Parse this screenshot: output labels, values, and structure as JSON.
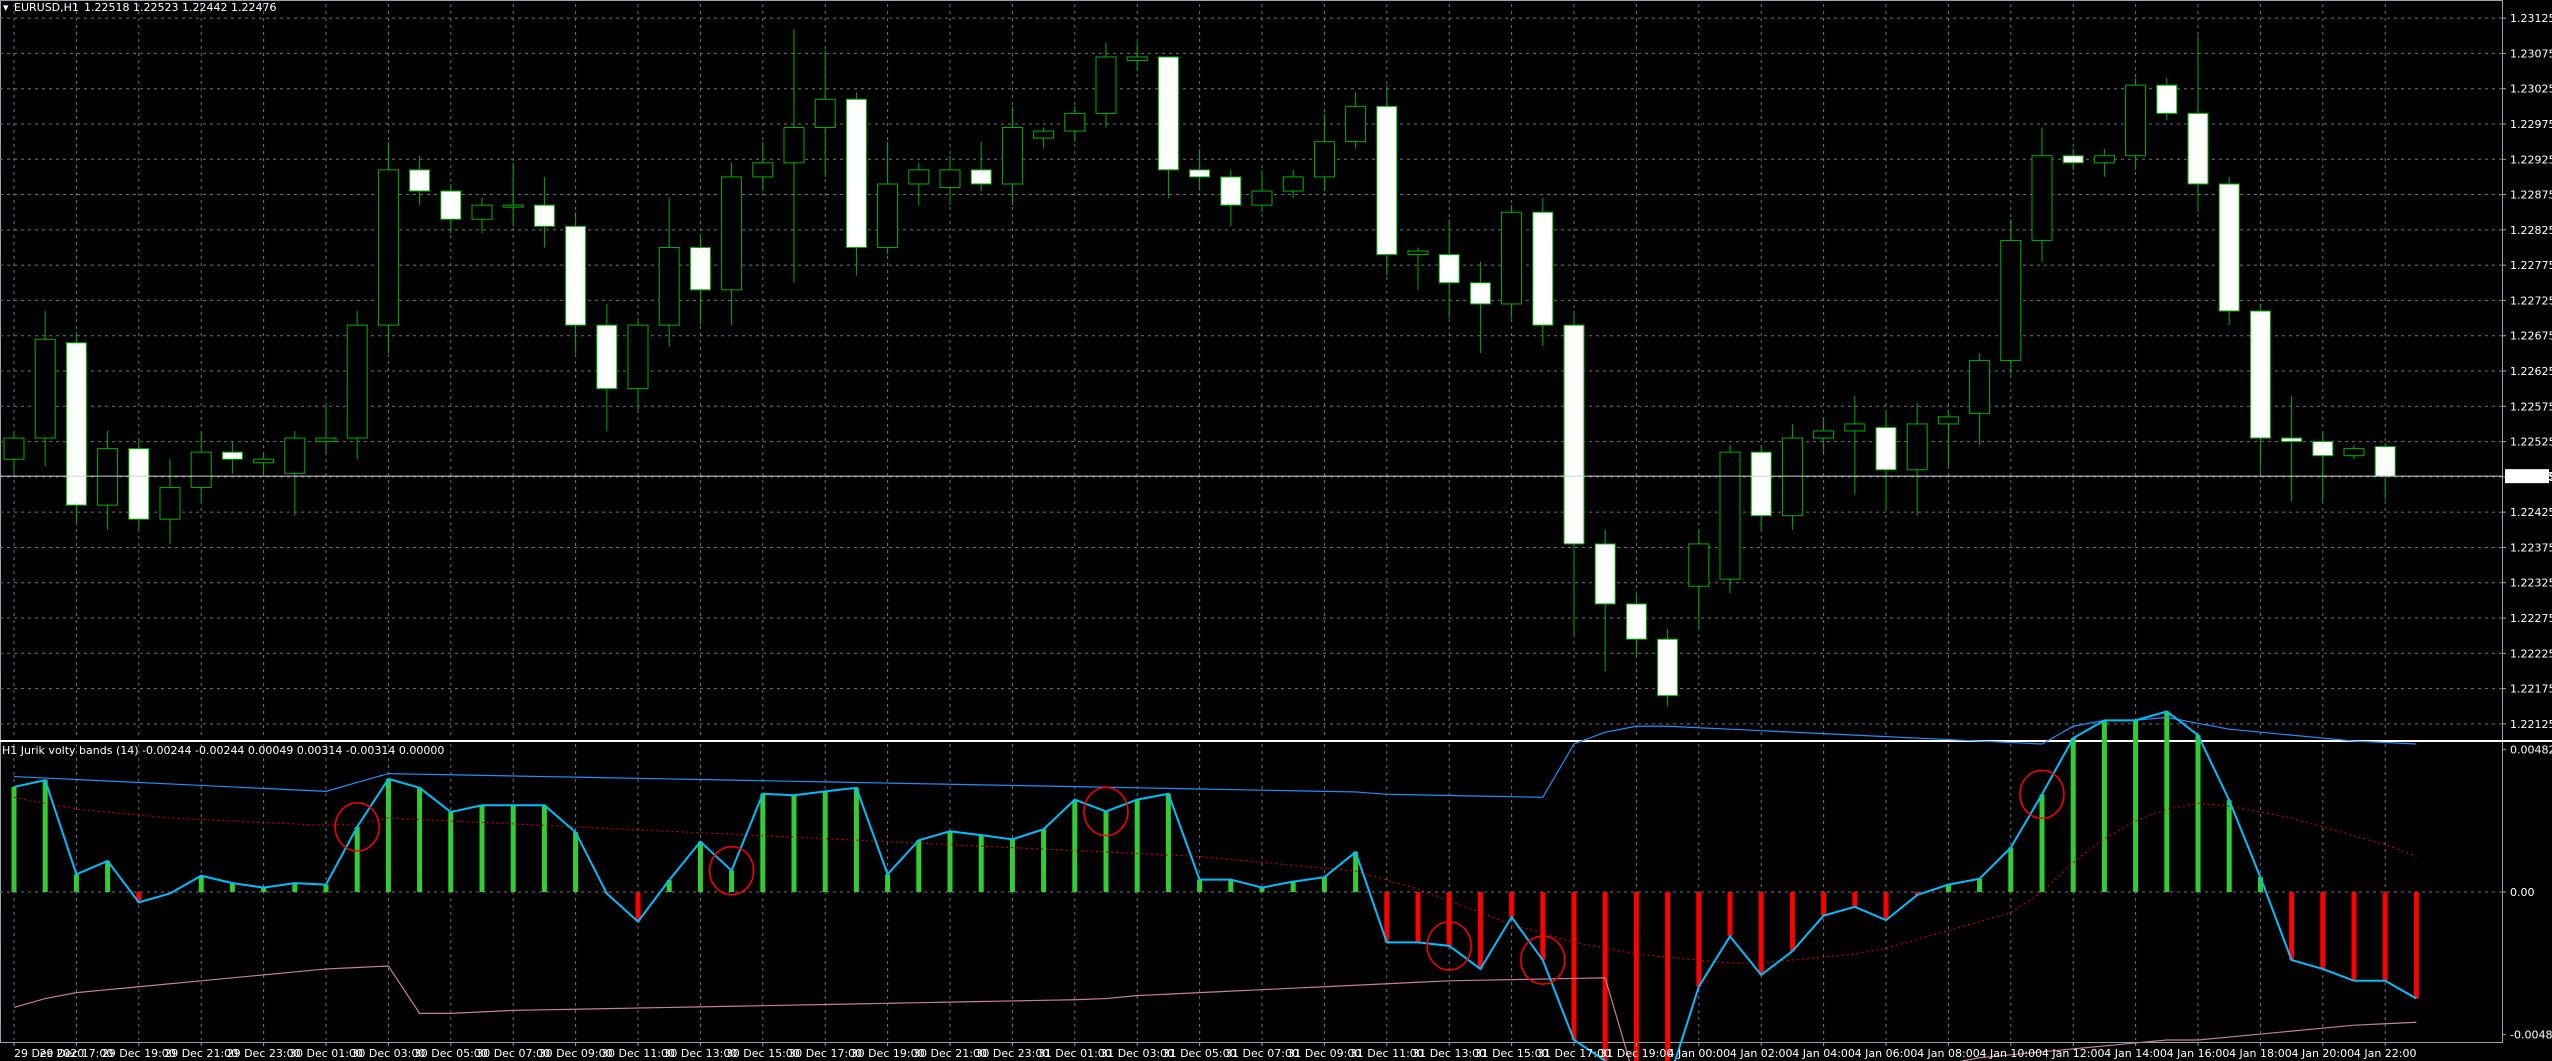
{
  "main": {
    "symbol_label": "EURUSD,H1",
    "ohlc_label": "1.22518 1.22523 1.22442 1.22476",
    "current_price_label": "1.22476"
  },
  "indicator": {
    "label": "H1 Jurik volty bands (14) -0.00244 -0.00244 0.00049 0.00314 -0.00314 0.00000"
  },
  "colors": {
    "background": "#000000",
    "grid": "#6b7280",
    "bull_candle": "#00b000",
    "bear_candle": "#ffffff",
    "hist_up": "#32cd32",
    "hist_down": "#ff0000",
    "main_line": "#00bfff",
    "upper_band": "#1e90ff",
    "lower_band": "#c77da0",
    "signal_line": "#cc0000",
    "circle": "#ff0000"
  },
  "chart_data": [
    {
      "type": "candlestick",
      "title": "EURUSD,H1",
      "y_ticks": [
        "1.23125",
        "1.23075",
        "1.23025",
        "1.22975",
        "1.22925",
        "1.22875",
        "1.22825",
        "1.22775",
        "1.22725",
        "1.22675",
        "1.22625",
        "1.22575",
        "1.22525",
        "1.22475",
        "1.22425",
        "1.22375",
        "1.22325",
        "1.22275",
        "1.22225",
        "1.22175",
        "1.22125"
      ],
      "ylim": [
        1.22105,
        1.23145
      ],
      "x_tick_labels": [
        "29 Dec 2020",
        "29 Dec 17:00",
        "29 Dec 19:00",
        "29 Dec 21:00",
        "29 Dec 23:00",
        "30 Dec 01:00",
        "30 Dec 03:00",
        "30 Dec 05:00",
        "30 Dec 07:00",
        "30 Dec 09:00",
        "30 Dec 11:00",
        "30 Dec 13:00",
        "30 Dec 15:00",
        "30 Dec 17:00",
        "30 Dec 19:00",
        "30 Dec 21:00",
        "30 Dec 23:00",
        "31 Dec 01:00",
        "31 Dec 03:00",
        "31 Dec 05:00",
        "31 Dec 07:00",
        "31 Dec 09:00",
        "31 Dec 11:00",
        "31 Dec 13:00",
        "31 Dec 15:00",
        "31 Dec 17:00",
        "31 Dec 19:00",
        "4 Jan 00:00",
        "4 Jan 02:00",
        "4 Jan 04:00",
        "4 Jan 06:00",
        "4 Jan 08:00",
        "4 Jan 10:00",
        "4 Jan 12:00",
        "4 Jan 14:00",
        "4 Jan 16:00",
        "4 Jan 18:00",
        "4 Jan 20:00",
        "4 Jan 22:00"
      ],
      "current_price": 1.22476,
      "candles": [
        {
          "o": 1.225,
          "h": 1.2254,
          "l": 1.2248,
          "c": 1.2253
        },
        {
          "o": 1.2253,
          "h": 1.2271,
          "l": 1.2249,
          "c": 1.2267
        },
        {
          "o": 1.22665,
          "h": 1.2268,
          "l": 1.2241,
          "c": 1.22435
        },
        {
          "o": 1.22435,
          "h": 1.2254,
          "l": 1.224,
          "c": 1.22515
        },
        {
          "o": 1.22515,
          "h": 1.2253,
          "l": 1.224,
          "c": 1.22415
        },
        {
          "o": 1.22415,
          "h": 1.225,
          "l": 1.2238,
          "c": 1.2246
        },
        {
          "o": 1.2246,
          "h": 1.2254,
          "l": 1.2244,
          "c": 1.2251
        },
        {
          "o": 1.2251,
          "h": 1.22525,
          "l": 1.2248,
          "c": 1.225
        },
        {
          "o": 1.22495,
          "h": 1.2251,
          "l": 1.2248,
          "c": 1.225
        },
        {
          "o": 1.2248,
          "h": 1.2254,
          "l": 1.2242,
          "c": 1.2253
        },
        {
          "o": 1.22525,
          "h": 1.2258,
          "l": 1.2251,
          "c": 1.2253
        },
        {
          "o": 1.2253,
          "h": 1.2271,
          "l": 1.225,
          "c": 1.2269
        },
        {
          "o": 1.2269,
          "h": 1.2295,
          "l": 1.2265,
          "c": 1.2291
        },
        {
          "o": 1.2291,
          "h": 1.2293,
          "l": 1.2286,
          "c": 1.2288
        },
        {
          "o": 1.2288,
          "h": 1.2289,
          "l": 1.2282,
          "c": 1.2284
        },
        {
          "o": 1.2284,
          "h": 1.2287,
          "l": 1.2282,
          "c": 1.2286
        },
        {
          "o": 1.2286,
          "h": 1.2292,
          "l": 1.2283,
          "c": 1.2286
        },
        {
          "o": 1.2286,
          "h": 1.229,
          "l": 1.228,
          "c": 1.2283
        },
        {
          "o": 1.2283,
          "h": 1.2285,
          "l": 1.2265,
          "c": 1.2269
        },
        {
          "o": 1.2269,
          "h": 1.2272,
          "l": 1.2254,
          "c": 1.226
        },
        {
          "o": 1.226,
          "h": 1.227,
          "l": 1.2257,
          "c": 1.2269
        },
        {
          "o": 1.2269,
          "h": 1.2287,
          "l": 1.2266,
          "c": 1.228
        },
        {
          "o": 1.228,
          "h": 1.2282,
          "l": 1.2269,
          "c": 1.2274
        },
        {
          "o": 1.2274,
          "h": 1.2292,
          "l": 1.2269,
          "c": 1.229
        },
        {
          "o": 1.229,
          "h": 1.2295,
          "l": 1.2288,
          "c": 1.2292
        },
        {
          "o": 1.2292,
          "h": 1.2311,
          "l": 1.2275,
          "c": 1.2297
        },
        {
          "o": 1.2297,
          "h": 1.2308,
          "l": 1.229,
          "c": 1.2301
        },
        {
          "o": 1.2301,
          "h": 1.2302,
          "l": 1.2276,
          "c": 1.228
        },
        {
          "o": 1.228,
          "h": 1.2295,
          "l": 1.2279,
          "c": 1.2289
        },
        {
          "o": 1.2289,
          "h": 1.2292,
          "l": 1.2286,
          "c": 1.2291
        },
        {
          "o": 1.22885,
          "h": 1.2293,
          "l": 1.2286,
          "c": 1.2291
        },
        {
          "o": 1.2291,
          "h": 1.2295,
          "l": 1.2288,
          "c": 1.2289
        },
        {
          "o": 1.2289,
          "h": 1.23,
          "l": 1.2286,
          "c": 1.2297
        },
        {
          "o": 1.22955,
          "h": 1.2297,
          "l": 1.2294,
          "c": 1.22965
        },
        {
          "o": 1.22965,
          "h": 1.23,
          "l": 1.2295,
          "c": 1.2299
        },
        {
          "o": 1.2299,
          "h": 1.2309,
          "l": 1.2297,
          "c": 1.2307
        },
        {
          "o": 1.23065,
          "h": 1.2309,
          "l": 1.2305,
          "c": 1.2307
        },
        {
          "o": 1.2307,
          "h": 1.2307,
          "l": 1.2287,
          "c": 1.2291
        },
        {
          "o": 1.2291,
          "h": 1.2294,
          "l": 1.2288,
          "c": 1.229
        },
        {
          "o": 1.229,
          "h": 1.2291,
          "l": 1.2283,
          "c": 1.2286
        },
        {
          "o": 1.2286,
          "h": 1.2291,
          "l": 1.2285,
          "c": 1.2288
        },
        {
          "o": 1.2288,
          "h": 1.2291,
          "l": 1.2287,
          "c": 1.229
        },
        {
          "o": 1.229,
          "h": 1.2299,
          "l": 1.2288,
          "c": 1.2295
        },
        {
          "o": 1.2295,
          "h": 1.2302,
          "l": 1.2294,
          "c": 1.23
        },
        {
          "o": 1.23,
          "h": 1.2303,
          "l": 1.2276,
          "c": 1.2279
        },
        {
          "o": 1.2279,
          "h": 1.228,
          "l": 1.2274,
          "c": 1.22795
        },
        {
          "o": 1.2279,
          "h": 1.2284,
          "l": 1.227,
          "c": 1.2275
        },
        {
          "o": 1.2275,
          "h": 1.2278,
          "l": 1.2265,
          "c": 1.2272
        },
        {
          "o": 1.2272,
          "h": 1.2286,
          "l": 1.227,
          "c": 1.2285
        },
        {
          "o": 1.2285,
          "h": 1.2287,
          "l": 1.2266,
          "c": 1.2269
        },
        {
          "o": 1.2269,
          "h": 1.2271,
          "l": 1.2225,
          "c": 1.2238
        },
        {
          "o": 1.2238,
          "h": 1.224,
          "l": 1.222,
          "c": 1.22295
        },
        {
          "o": 1.22295,
          "h": 1.2231,
          "l": 1.2222,
          "c": 1.22245
        },
        {
          "o": 1.22245,
          "h": 1.2226,
          "l": 1.2215,
          "c": 1.22165
        },
        {
          "o": 1.2232,
          "h": 1.224,
          "l": 1.2226,
          "c": 1.2238
        },
        {
          "o": 1.2233,
          "h": 1.2252,
          "l": 1.2231,
          "c": 1.2251
        },
        {
          "o": 1.2251,
          "h": 1.2252,
          "l": 1.224,
          "c": 1.2242
        },
        {
          "o": 1.2242,
          "h": 1.2255,
          "l": 1.224,
          "c": 1.2253
        },
        {
          "o": 1.2253,
          "h": 1.2256,
          "l": 1.2251,
          "c": 1.2254
        },
        {
          "o": 1.2254,
          "h": 1.2259,
          "l": 1.2245,
          "c": 1.2255
        },
        {
          "o": 1.22545,
          "h": 1.2257,
          "l": 1.2243,
          "c": 1.22485
        },
        {
          "o": 1.22485,
          "h": 1.2258,
          "l": 1.2242,
          "c": 1.2255
        },
        {
          "o": 1.2255,
          "h": 1.2257,
          "l": 1.2249,
          "c": 1.2256
        },
        {
          "o": 1.22565,
          "h": 1.2265,
          "l": 1.2252,
          "c": 1.2264
        },
        {
          "o": 1.2264,
          "h": 1.2284,
          "l": 1.2262,
          "c": 1.2281
        },
        {
          "o": 1.2281,
          "h": 1.2297,
          "l": 1.2278,
          "c": 1.2293
        },
        {
          "o": 1.2293,
          "h": 1.2294,
          "l": 1.2291,
          "c": 1.2292
        },
        {
          "o": 1.2292,
          "h": 1.2294,
          "l": 1.229,
          "c": 1.2293
        },
        {
          "o": 1.2293,
          "h": 1.2304,
          "l": 1.2291,
          "c": 1.2303
        },
        {
          "o": 1.2303,
          "h": 1.2304,
          "l": 1.2298,
          "c": 1.2299
        },
        {
          "o": 1.2299,
          "h": 1.231,
          "l": 1.2285,
          "c": 1.2289
        },
        {
          "o": 1.2289,
          "h": 1.229,
          "l": 1.2269,
          "c": 1.2271
        },
        {
          "o": 1.2271,
          "h": 1.2272,
          "l": 1.2248,
          "c": 1.2253
        },
        {
          "o": 1.2253,
          "h": 1.2259,
          "l": 1.2244,
          "c": 1.22525
        },
        {
          "o": 1.22525,
          "h": 1.2254,
          "l": 1.2244,
          "c": 1.22505
        },
        {
          "o": 1.22505,
          "h": 1.2252,
          "l": 1.225,
          "c": 1.22515
        },
        {
          "o": 1.22518,
          "h": 1.22523,
          "l": 1.22442,
          "c": 1.22476
        }
      ]
    },
    {
      "type": "histogram+lines",
      "title": "H1 Jurik volty bands (14)",
      "y_ticks": [
        "0.00482",
        "0.00",
        "-0.00482"
      ],
      "ylim": [
        -0.005,
        0.005
      ],
      "histogram": [
        0.00355,
        0.00378,
        0.0006,
        0.00105,
        -0.00035,
        -5e-05,
        0.00055,
        0.0003,
        0.00015,
        0.0003,
        0.00025,
        0.0022,
        0.00382,
        0.00352,
        0.0027,
        0.00293,
        0.00293,
        0.00293,
        0.00202,
        -5e-05,
        -0.001,
        0.0004,
        0.0017,
        0.00072,
        0.00332,
        0.00327,
        0.0034,
        0.00352,
        0.0006,
        0.00175,
        0.00205,
        0.00192,
        0.00178,
        0.00212,
        0.00312,
        0.00272,
        0.00312,
        0.00332,
        0.00042,
        0.00042,
        0.00015,
        0.00035,
        0.0005,
        0.00135,
        -0.0017,
        -0.0017,
        -0.00182,
        -0.0026,
        -0.00085,
        -0.0023,
        -0.005,
        -0.0057,
        -0.0065,
        -0.0065,
        -0.0032,
        -0.0015,
        -0.0028,
        -0.002,
        -0.0008,
        -0.0005,
        -0.00095,
        -0.0001,
        0.00025,
        0.00045,
        0.0015,
        0.0033,
        0.0052,
        0.0058,
        0.0058,
        0.0061,
        0.0053,
        0.0031,
        0.0005,
        -0.0023,
        -0.0026,
        -0.003,
        -0.003,
        -0.0036
      ],
      "upper_band": [
        0.0039,
        0.00385,
        0.0038,
        0.00375,
        0.0037,
        0.00365,
        0.0036,
        0.00355,
        0.0035,
        0.00345,
        0.0034,
        0.0037,
        0.004,
        0.00398,
        0.00396,
        0.00394,
        0.00392,
        0.0039,
        0.00388,
        0.00386,
        0.00384,
        0.00382,
        0.0038,
        0.00378,
        0.00376,
        0.00374,
        0.00372,
        0.0037,
        0.00368,
        0.00366,
        0.00364,
        0.00362,
        0.0036,
        0.00358,
        0.00356,
        0.00354,
        0.00352,
        0.0035,
        0.00348,
        0.00346,
        0.00344,
        0.00342,
        0.0034,
        0.00338,
        0.0033,
        0.00328,
        0.00326,
        0.00324,
        0.00322,
        0.0032,
        0.005,
        0.0054,
        0.0056,
        0.0056,
        0.00555,
        0.0055,
        0.00545,
        0.0054,
        0.00535,
        0.0053,
        0.00525,
        0.0052,
        0.00515,
        0.0051,
        0.00505,
        0.005,
        0.0056,
        0.0058,
        0.0058,
        0.0059,
        0.0057,
        0.0055,
        0.0054,
        0.0053,
        0.0052,
        0.0051,
        0.00505,
        0.005
      ],
      "lower_band": [
        -0.0039,
        -0.0036,
        -0.0034,
        -0.0033,
        -0.0032,
        -0.0031,
        -0.003,
        -0.0029,
        -0.0028,
        -0.0027,
        -0.0026,
        -0.00255,
        -0.0025,
        -0.0041,
        -0.0041,
        -0.00405,
        -0.004,
        -0.00398,
        -0.00396,
        -0.00394,
        -0.00392,
        -0.0039,
        -0.00388,
        -0.00386,
        -0.00384,
        -0.00382,
        -0.0038,
        -0.00378,
        -0.00376,
        -0.00374,
        -0.00372,
        -0.0037,
        -0.00368,
        -0.00366,
        -0.00364,
        -0.0036,
        -0.0035,
        -0.00345,
        -0.0034,
        -0.00335,
        -0.0033,
        -0.00325,
        -0.0032,
        -0.00315,
        -0.0031,
        -0.00305,
        -0.003,
        -0.00298,
        -0.00296,
        -0.00294,
        -0.00292,
        -0.0029,
        -0.0065,
        -0.0066,
        -0.0065,
        -0.0064,
        -0.00635,
        -0.0063,
        -0.00625,
        -0.0062,
        -0.006,
        -0.0059,
        -0.0058,
        -0.0056,
        -0.0055,
        -0.0054,
        -0.0053,
        -0.0052,
        -0.0051,
        -0.005,
        -0.005,
        -0.0049,
        -0.0048,
        -0.0047,
        -0.0046,
        -0.0045,
        -0.00445,
        -0.0044
      ],
      "signal_line": [
        0.0032,
        0.003,
        0.0028,
        0.0027,
        0.0026,
        0.0025,
        0.00245,
        0.0024,
        0.00235,
        0.0023,
        0.00225,
        0.0023,
        0.0025,
        0.00245,
        0.0024,
        0.00235,
        0.0023,
        0.00225,
        0.0022,
        0.00215,
        0.0021,
        0.00205,
        0.002,
        0.00195,
        0.0019,
        0.00185,
        0.0018,
        0.00175,
        0.0017,
        0.00165,
        0.0016,
        0.00155,
        0.0015,
        0.00145,
        0.0014,
        0.00135,
        0.0013,
        0.00125,
        0.0012,
        0.0011,
        0.001,
        0.0009,
        0.0008,
        0.0007,
        0.0004,
        0.0001,
        -0.0003,
        -0.0007,
        -0.0011,
        -0.0014,
        -0.0017,
        -0.0019,
        -0.0021,
        -0.0022,
        -0.0023,
        -0.0024,
        -0.0024,
        -0.0023,
        -0.0022,
        -0.0021,
        -0.0019,
        -0.0016,
        -0.0013,
        -0.001,
        -0.0007,
        0.0,
        0.001,
        0.0018,
        0.0024,
        0.0028,
        0.003,
        0.0029,
        0.0027,
        0.0025,
        0.0022,
        0.0019,
        0.0016,
        0.0012
      ],
      "annotations": [
        {
          "type": "circle",
          "bar": 11
        },
        {
          "type": "circle",
          "bar": 23
        },
        {
          "type": "circle",
          "bar": 35
        },
        {
          "type": "circle",
          "bar": 46
        },
        {
          "type": "circle",
          "bar": 49
        },
        {
          "type": "circle",
          "bar": 65
        }
      ]
    }
  ]
}
